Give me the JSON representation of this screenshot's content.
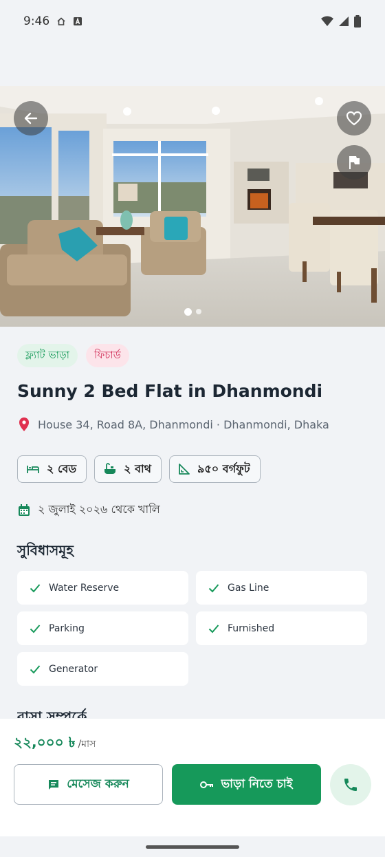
{
  "status_bar": {
    "time": "9:46"
  },
  "listing": {
    "chips": [
      "ফ্ল্যাট ভাড়া",
      "ফিচার্ড"
    ],
    "title": "Sunny 2 Bed Flat in Dhanmondi",
    "address": "House 34, Road 8A, Dhanmondi · Dhanmondi, Dhaka",
    "specs": {
      "beds": "২ বেড",
      "baths": "২ বাথ",
      "area": "৯৫০ বর্গফুট"
    },
    "available_from": "২ জুলাই ২০২৬ থেকে খালি",
    "amenities_title": "সুবিধাসমূহ",
    "amenities": [
      "Water Reserve",
      "Gas Line",
      "Parking",
      "Furnished",
      "Generator"
    ],
    "next_section_title": "বাসা সম্পর্কে"
  },
  "gallery": {
    "current_index": 1,
    "total": 2
  },
  "footer": {
    "price": "২২,০০০ ৳",
    "per": "/মাস",
    "message_button": "মেসেজ করুন",
    "rent_button": "ভাড়া নিতে চাই"
  },
  "colors": {
    "accent": "#16995a",
    "chip_pink": "#d12d57",
    "pin": "#e0304f"
  },
  "icons": [
    "back-arrow-icon",
    "heart-icon",
    "flag-icon",
    "location-pin-icon",
    "bed-icon",
    "bath-icon",
    "area-icon",
    "calendar-icon",
    "check-icon",
    "chat-icon",
    "key-icon",
    "phone-icon"
  ]
}
